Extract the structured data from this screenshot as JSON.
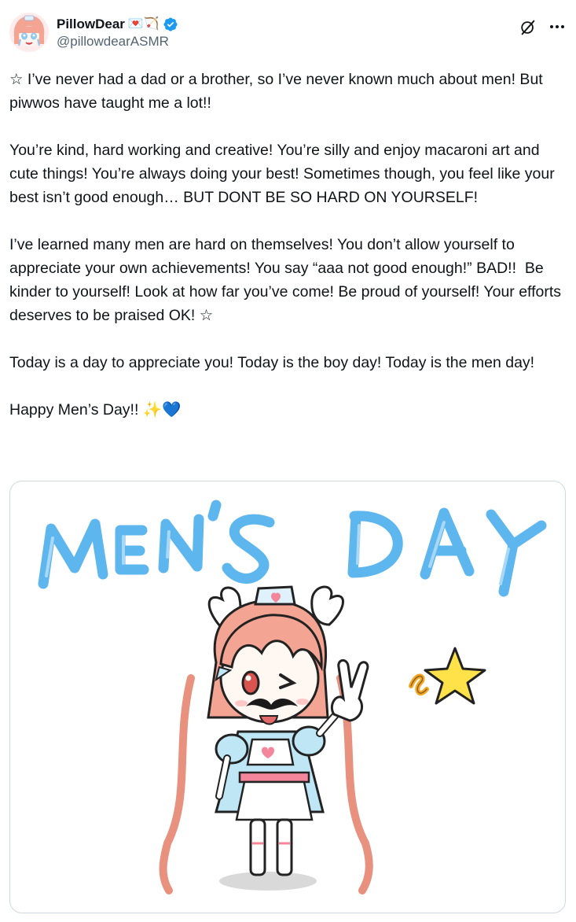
{
  "author": {
    "display_name": "PillowDear",
    "name_emojis": "💌🏹",
    "handle": "@pillowdearASMR",
    "verified": true,
    "avatar_icon": "avatar-pink-haired-anime-girl"
  },
  "actions": {
    "grok_icon": "grok-icon",
    "more_icon": "more-icon"
  },
  "post": {
    "paragraphs": [
      "☆ I’ve never had a dad or a brother, so I’ve never known much about men! But piwwos have taught me a lot!!",
      "You’re kind, hard working and creative! You’re silly and enjoy macaroni art and cute things! You’re always doing your best! Sometimes though, you feel like your best isn’t good enough… BUT DONT BE SO HARD ON YOURSELF!",
      "I’ve learned many men are hard on themselves! You don’t allow yourself to appreciate your own achievements! You say “aaa not good enough!” BAD!!  Be kinder to yourself! Look at how far you’ve come! Be proud of yourself! Your efforts deserves to be praised OK! ☆",
      "Today is a day to appreciate you! Today is the boy day! Today is the men day!",
      "Happy Men’s Day!! ✨💙"
    ]
  },
  "media": {
    "headline": "MENS DAY",
    "description_icon": "mens-day-illustration"
  },
  "colors": {
    "verified_blue": "#1d9bf0",
    "text_primary": "#0f1419",
    "text_secondary": "#536471",
    "border": "#cfd9de",
    "headline_blue": "#5db6ee"
  }
}
